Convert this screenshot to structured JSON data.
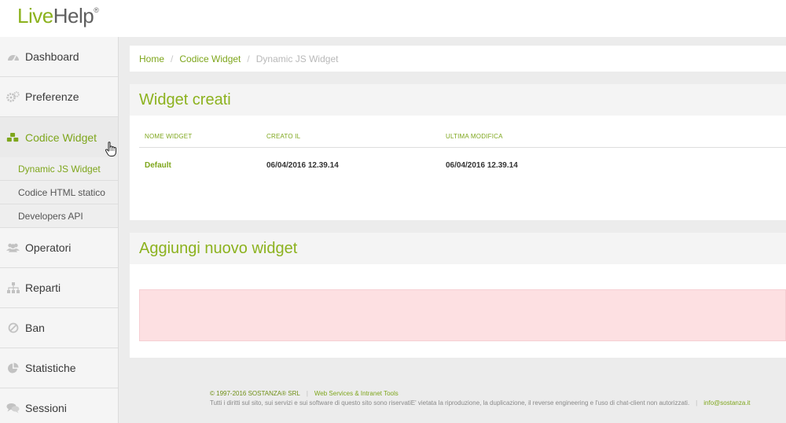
{
  "brand": {
    "live": "Live",
    "help": "Help",
    "reg": "®"
  },
  "sidebar": {
    "items": [
      {
        "label": "Dashboard",
        "icon": "dashboard-icon"
      },
      {
        "label": "Preferenze",
        "icon": "gears-icon"
      },
      {
        "label": "Codice Widget",
        "icon": "cubes-icon",
        "active": true
      },
      {
        "label": "Operatori",
        "icon": "users-icon"
      },
      {
        "label": "Reparti",
        "icon": "sitemap-icon"
      },
      {
        "label": "Ban",
        "icon": "ban-icon"
      },
      {
        "label": "Statistiche",
        "icon": "pie-chart-icon"
      },
      {
        "label": "Sessioni",
        "icon": "comments-icon"
      }
    ],
    "subitems": [
      {
        "label": "Dynamic JS Widget",
        "selected": true
      },
      {
        "label": "Codice HTML statico"
      },
      {
        "label": "Developers API"
      }
    ]
  },
  "breadcrumb": {
    "home": "Home",
    "section": "Codice Widget",
    "current": "Dynamic JS Widget",
    "sep": "/"
  },
  "widgets_panel": {
    "title": "Widget creati",
    "columns": [
      "NOME WIDGET",
      "CREATO IL",
      "ULTIMA MODIFICA"
    ],
    "rows": [
      {
        "name": "Default",
        "created": "06/04/2016 12.39.14",
        "modified": "06/04/2016 12.39.14"
      }
    ]
  },
  "add_panel": {
    "title": "Aggiungi nuovo widget"
  },
  "footer": {
    "copyright": "© 1997-2016 SOSTANZA® SRL",
    "link": "Web Services & Intranet Tools",
    "rights": "Tutti i diritti sul sito, sui servizi e sui software di questo sito sono riservatiE' vietata la riproduzione, la duplicazione, il reverse engineering e l'uso di chat-client non autorizzati.",
    "email": "info@sostanza.it",
    "sep": "|"
  },
  "colors": {
    "accent": "#8cb21e",
    "alert_bg": "#fde0e2"
  }
}
